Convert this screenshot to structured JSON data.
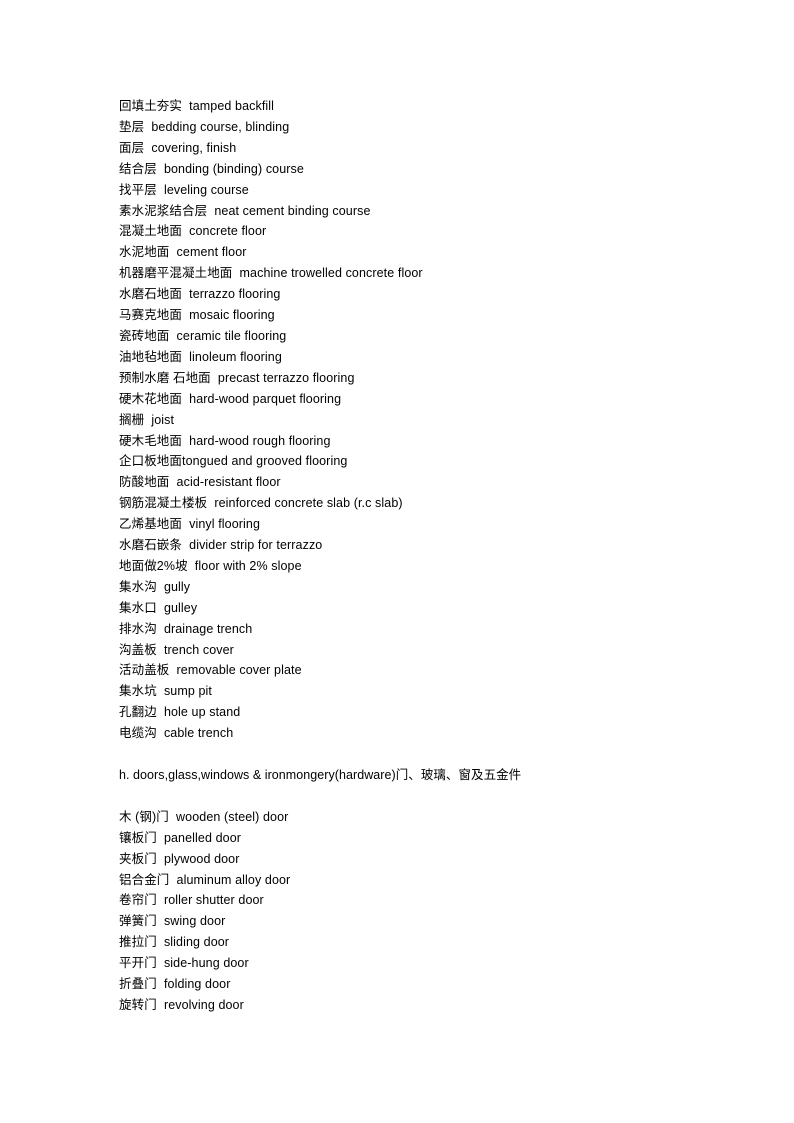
{
  "document": {
    "title": "Construction Terminology Glossary",
    "language": "zh-en",
    "text_color": "#000000",
    "background_color": "#ffffff",
    "blocks": [
      {
        "id": "flooring-terms",
        "type": "glossary-list",
        "lines": [
          "回填土夯实  tamped backfill",
          "垫层  bedding course, blinding",
          "面层  covering, finish",
          "结合层  bonding (binding) course",
          "找平层  leveling course",
          "素水泥浆结合层  neat cement binding course",
          "混凝土地面  concrete floor",
          "水泥地面  cement floor",
          "机器磨平混凝土地面  machine trowelled concrete floor",
          "水磨石地面  terrazzo flooring",
          "马赛克地面  mosaic flooring",
          "瓷砖地面  ceramic tile flooring",
          "油地毡地面  linoleum flooring",
          "预制水磨 石地面  precast terrazzo flooring",
          "硬木花地面  hard-wood parquet flooring",
          "搁栅  joist",
          "硬木毛地面  hard-wood rough flooring",
          "企口板地面tongued and grooved flooring",
          "防酸地面  acid-resistant floor",
          "钢筋混凝土楼板  reinforced concrete slab (r.c slab)",
          "乙烯基地面  vinyl flooring",
          "水磨石嵌条  divider strip for terrazzo",
          "地面做2%坡  floor with 2% slope",
          "集水沟  gully",
          "集水口  gulley",
          "排水沟  drainage trench",
          "沟盖板  trench cover",
          "活动盖板  removable cover plate",
          "集水坑  sump pit",
          "孔翻边  hole up stand",
          "电缆沟  cable trench"
        ]
      },
      {
        "id": "section-heading-h",
        "type": "section-heading",
        "lines": [
          "h. doors,glass,windows & ironmongery(hardware)门、玻璃、窗及五金件"
        ]
      },
      {
        "id": "door-terms",
        "type": "glossary-list",
        "lines": [
          "木 (钢)门  wooden (steel) door",
          "镶板门  panelled door",
          "夹板门  plywood door",
          "铝合金门  aluminum alloy door",
          "卷帘门  roller shutter door",
          "弹簧门  swing door",
          "推拉门  sliding door",
          "平开门  side-hung door",
          "折叠门  folding door",
          "旋转门  revolving door"
        ]
      }
    ]
  }
}
